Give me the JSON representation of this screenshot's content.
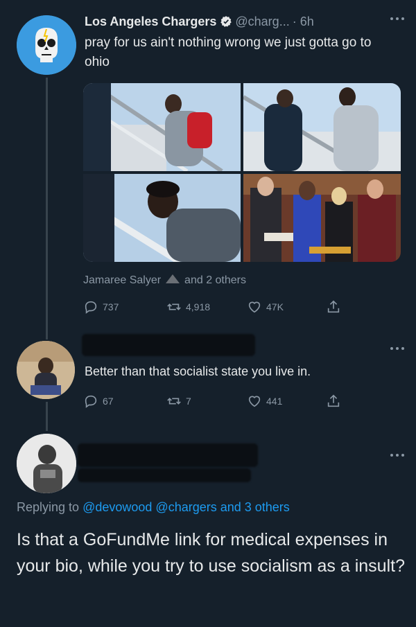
{
  "tweet1": {
    "author_name": "Los Angeles Chargers",
    "handle": "@charg...",
    "time": "· 6h",
    "text": "pray for us ain't nothing wrong we just gotta go to ohio",
    "liked_by_name": "Jamaree Salyer",
    "liked_by_rest": "and 2 others",
    "stats": {
      "replies": "737",
      "retweets": "4,918",
      "likes": "47K"
    }
  },
  "tweet2": {
    "text": "Better than that socialist state you live in.",
    "stats": {
      "replies": "67",
      "retweets": "7",
      "likes": "441"
    }
  },
  "tweet3": {
    "replying_prefix": "Replying to",
    "replying_targets": "@devowood @chargers and 3 others",
    "text": "Is that a GoFundMe link for medical expenses in your bio, while you try to use socialism as a insult?"
  },
  "colors": {
    "background": "#15202b",
    "text": "#e7e9ea",
    "muted": "#8b98a5",
    "link": "#1d9bf0",
    "thread_line": "#38444d"
  },
  "icons": [
    "verified-badge-icon",
    "more-icon",
    "reply-icon",
    "retweet-icon",
    "like-icon",
    "share-icon"
  ]
}
